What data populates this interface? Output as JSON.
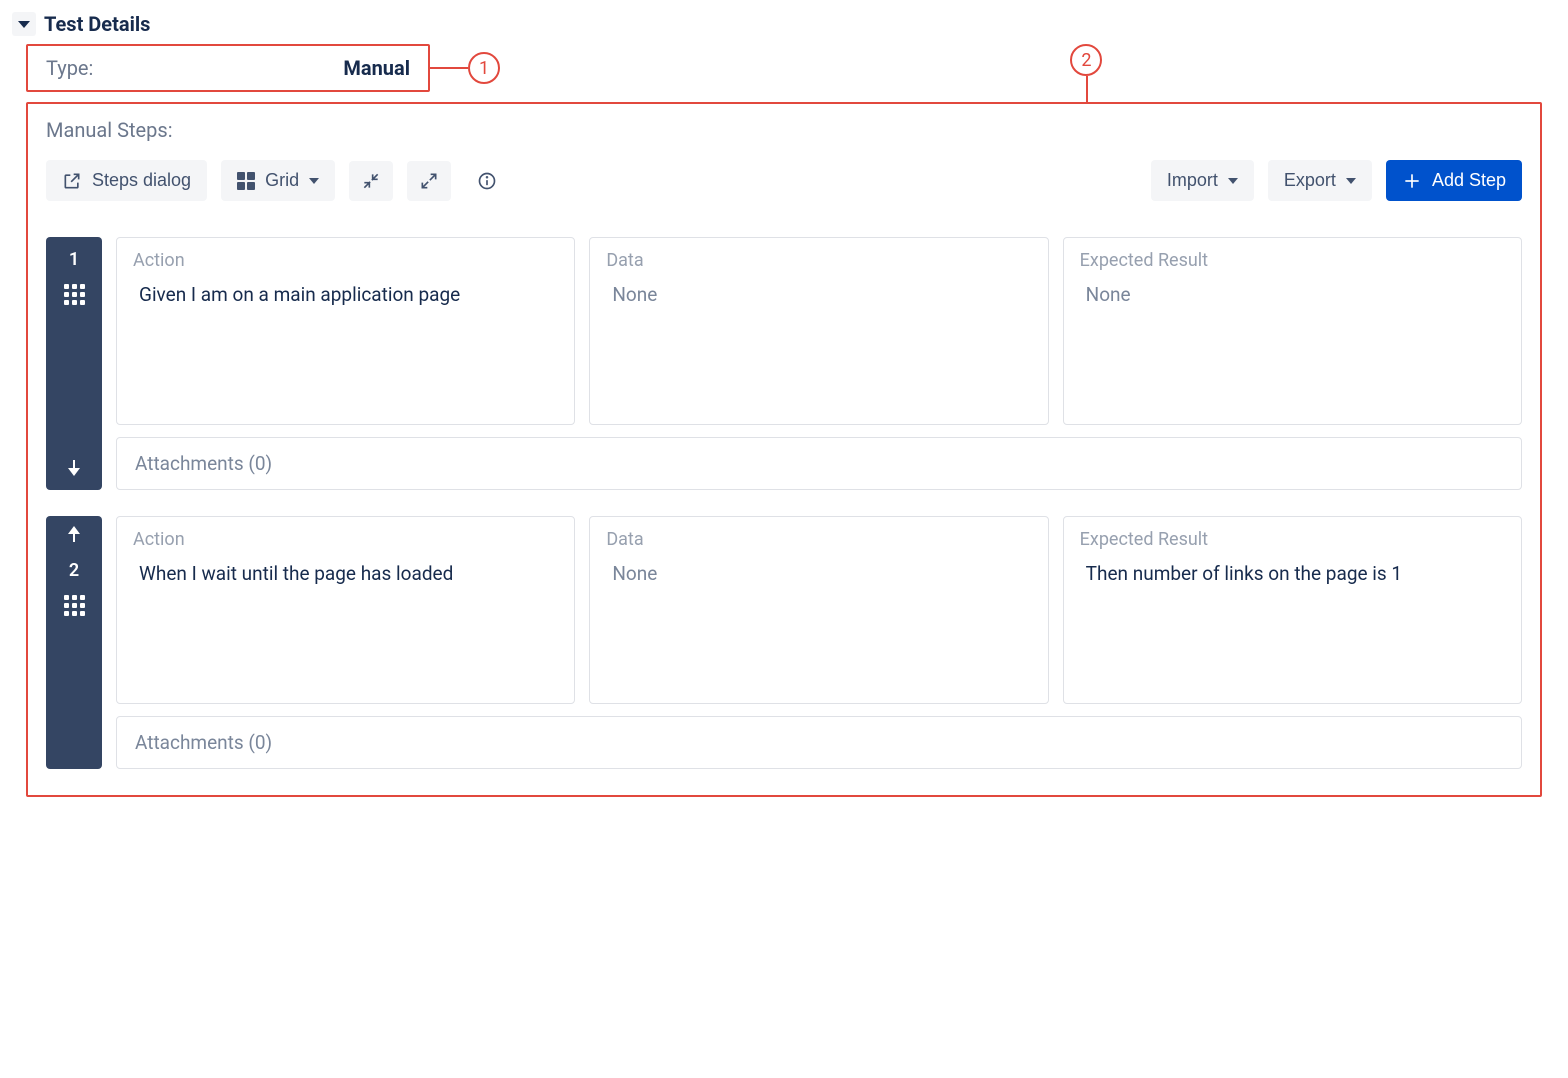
{
  "section": {
    "title": "Test Details"
  },
  "type_row": {
    "label": "Type:",
    "value": "Manual"
  },
  "callouts": {
    "one": "1",
    "two": "2"
  },
  "manual_steps": {
    "label": "Manual Steps:",
    "toolbar": {
      "steps_dialog": "Steps dialog",
      "grid": "Grid",
      "import": "Import",
      "export": "Export",
      "add_step": "Add Step"
    },
    "columns": {
      "action": "Action",
      "data": "Data",
      "expected": "Expected Result"
    },
    "placeholder_none": "None",
    "steps": [
      {
        "number": "1",
        "action": "Given I am on a main application page",
        "data": null,
        "expected": null,
        "attachments": "Attachments (0)"
      },
      {
        "number": "2",
        "action": "When I wait until the page has loaded",
        "data": null,
        "expected": "Then number of links on the page is 1",
        "attachments": "Attachments (0)"
      }
    ]
  }
}
